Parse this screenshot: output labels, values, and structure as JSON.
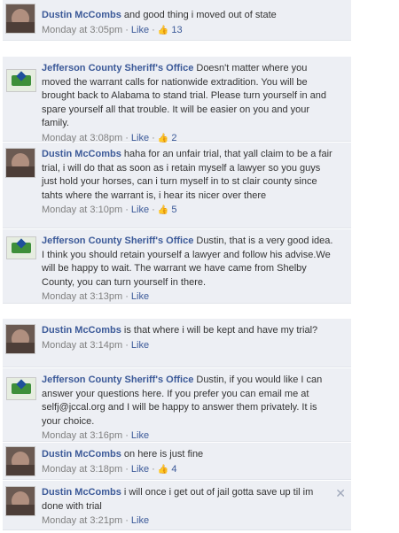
{
  "comments": [
    {
      "author": "Dustin McCombs",
      "text": "and good thing i moved out of state",
      "time": "Monday at 3:05pm",
      "sep": "·",
      "like": "Like",
      "likes": "13"
    },
    {
      "author": "Jefferson County Sheriff's Office",
      "text": "Doesn't matter where you moved the warrant calls for nationwide extradition. You will be brought back to Alabama to stand trial. Please turn yourself in and spare yourself all that trouble. It will be easier on you and your family.",
      "time": "Monday at 3:08pm",
      "sep": "·",
      "like": "Like",
      "likes": "2"
    },
    {
      "author": "Dustin McCombs",
      "text": "haha for an unfair trial, that yall claim to be a fair trial, i will do that as soon as i retain myself a lawyer so you guys just hold your horses, can i turn myself in to st clair county since tahts where the warrant is, i hear its nicer over there",
      "time": "Monday at 3:10pm",
      "sep": "·",
      "like": "Like",
      "likes": "5"
    },
    {
      "author": "Jefferson County Sheriff's Office",
      "text": "Dustin, that is a very good idea. I think you should retain yourself a lawyer and follow his advise.We will be happy to wait. The warrant we have came from Shelby County, you can turn yourself in there.",
      "time": "Monday at 3:13pm",
      "sep": "·",
      "like": "Like"
    },
    {
      "author": "Dustin McCombs",
      "text": "is that where i will be kept and have my trial?",
      "time": "Monday at 3:14pm",
      "sep": "·",
      "like": "Like"
    },
    {
      "author": "Jefferson County Sheriff's Office",
      "text": "Dustin, if you would like I can answer your questions here. If you prefer you can email me at selfj@jccal.org and I will be happy to answer them privately. It is your choice.",
      "time": "Monday at 3:16pm",
      "sep": "·",
      "like": "Like"
    },
    {
      "author": "Dustin McCombs",
      "text": "on here is just fine",
      "time": "Monday at 3:18pm",
      "sep": "·",
      "like": "Like",
      "likes": "4"
    },
    {
      "author": "Dustin McCombs",
      "text": "i will once i get out of jail gotta save up til im done with trial",
      "time": "Monday at 3:21pm",
      "sep": "·",
      "like": "Like"
    }
  ],
  "icons": {
    "thumb": "thumbs-up-icon",
    "remove": "close-icon"
  },
  "colors": {
    "link": "#3b5998",
    "background": "#edeff4",
    "meta": "#808080"
  }
}
